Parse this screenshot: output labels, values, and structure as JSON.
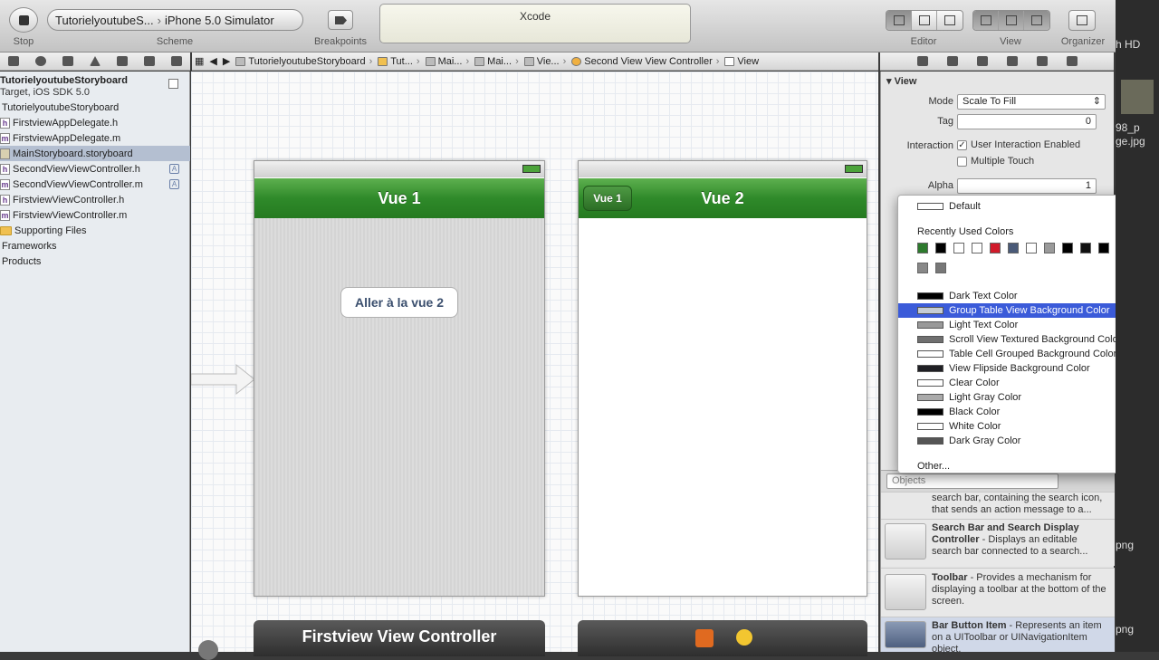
{
  "toolbar": {
    "stop_label": "Stop",
    "scheme_label": "Scheme",
    "scheme_target": "TutorielyoutubeS...",
    "scheme_sep": "›",
    "scheme_destination": "iPhone 5.0 Simulator",
    "breakpoints_label": "Breakpoints",
    "activity_title": "Xcode",
    "editor_label": "Editor",
    "view_label": "View",
    "organizer_label": "Organizer"
  },
  "jumpbar": {
    "items": [
      "TutorielyoutubeStoryboard",
      "Tut...",
      "Mai...",
      "Mai...",
      "Vie...",
      "Second View View Controller",
      "View"
    ]
  },
  "navigator": {
    "project_name": "TutorielyoutubeStoryboard",
    "project_subtitle": "Target, iOS SDK 5.0",
    "group_name": "TutorielyoutubeStoryboard",
    "files": [
      {
        "name": "FirstviewAppDelegate.h",
        "type": "h"
      },
      {
        "name": "FirstviewAppDelegate.m",
        "type": "m"
      },
      {
        "name": "MainStoryboard.storyboard",
        "type": "sb"
      },
      {
        "name": "SecondViewViewController.h",
        "type": "h",
        "badge": "A"
      },
      {
        "name": "SecondViewViewController.m",
        "type": "m",
        "badge": "A"
      },
      {
        "name": "FirstviewViewController.h",
        "type": "h"
      },
      {
        "name": "FirstviewViewController.m",
        "type": "m"
      }
    ],
    "supporting": "Supporting Files",
    "frameworks": "Frameworks",
    "products": "Products"
  },
  "canvas": {
    "scene1_title": "Vue 1",
    "scene1_button": "Aller à la vue 2",
    "scene1_dock": "Firstview View Controller",
    "scene2_title": "Vue 2",
    "scene2_back": "Vue 1"
  },
  "inspector": {
    "section": "View",
    "mode_label": "Mode",
    "mode_value": "Scale To Fill",
    "tag_label": "Tag",
    "tag_value": "0",
    "interaction_label": "Interaction",
    "user_interaction": "User Interaction Enabled",
    "multiple_touch": "Multiple Touch",
    "alpha_label": "Alpha",
    "alpha_value": "1",
    "library_filter": "Objects",
    "library": [
      {
        "text": "search bar, containing the search icon, that sends an action message to a..."
      },
      {
        "title": "Search Bar and Search Display Controller",
        "text": " - Displays an editable search bar connected to a search..."
      },
      {
        "title": "Toolbar",
        "text": " - Provides a mechanism for displaying a toolbar at the bottom of the screen."
      },
      {
        "title": "Bar Button Item",
        "text": " - Represents an item on a UIToolbar or UINavigationItem object."
      }
    ]
  },
  "color_popup": {
    "default": "Default",
    "recent_label": "Recently Used Colors",
    "recent_colors": [
      "#2d7a2d",
      "#000000",
      "#ffffff",
      "#ffffff",
      "#d11a2a",
      "#4a5a78",
      "#ffffff",
      "#9a9a9a",
      "#000000",
      "#111111",
      "#000000",
      "#555555",
      "#888888",
      "#777777"
    ],
    "items": [
      {
        "label": "Dark Text Color",
        "swatch": "#000000"
      },
      {
        "label": "Group Table View Background Color",
        "swatch": "#c5ccd4",
        "highlighted": true
      },
      {
        "label": "Light Text Color",
        "swatch": "#999999"
      },
      {
        "label": "Scroll View Textured Background Color",
        "swatch": "#6f6f6f"
      },
      {
        "label": "Table Cell Grouped Background Color",
        "swatch": "#ffffff"
      },
      {
        "label": "View Flipside Background Color",
        "swatch": "#1f1f24"
      },
      {
        "label": "Clear Color",
        "swatch": "#ffffff"
      },
      {
        "label": "Light Gray Color",
        "swatch": "#aaaaaa"
      },
      {
        "label": "Black Color",
        "swatch": "#000000"
      },
      {
        "label": "White Color",
        "swatch": "#ffffff"
      },
      {
        "label": "Dark Gray Color",
        "swatch": "#555555"
      }
    ],
    "other": "Other..."
  },
  "desktop": {
    "label1": "h HD",
    "label2": "98_p",
    "label3": "ge.jpg",
    "label4": "png",
    "label5": "png"
  }
}
